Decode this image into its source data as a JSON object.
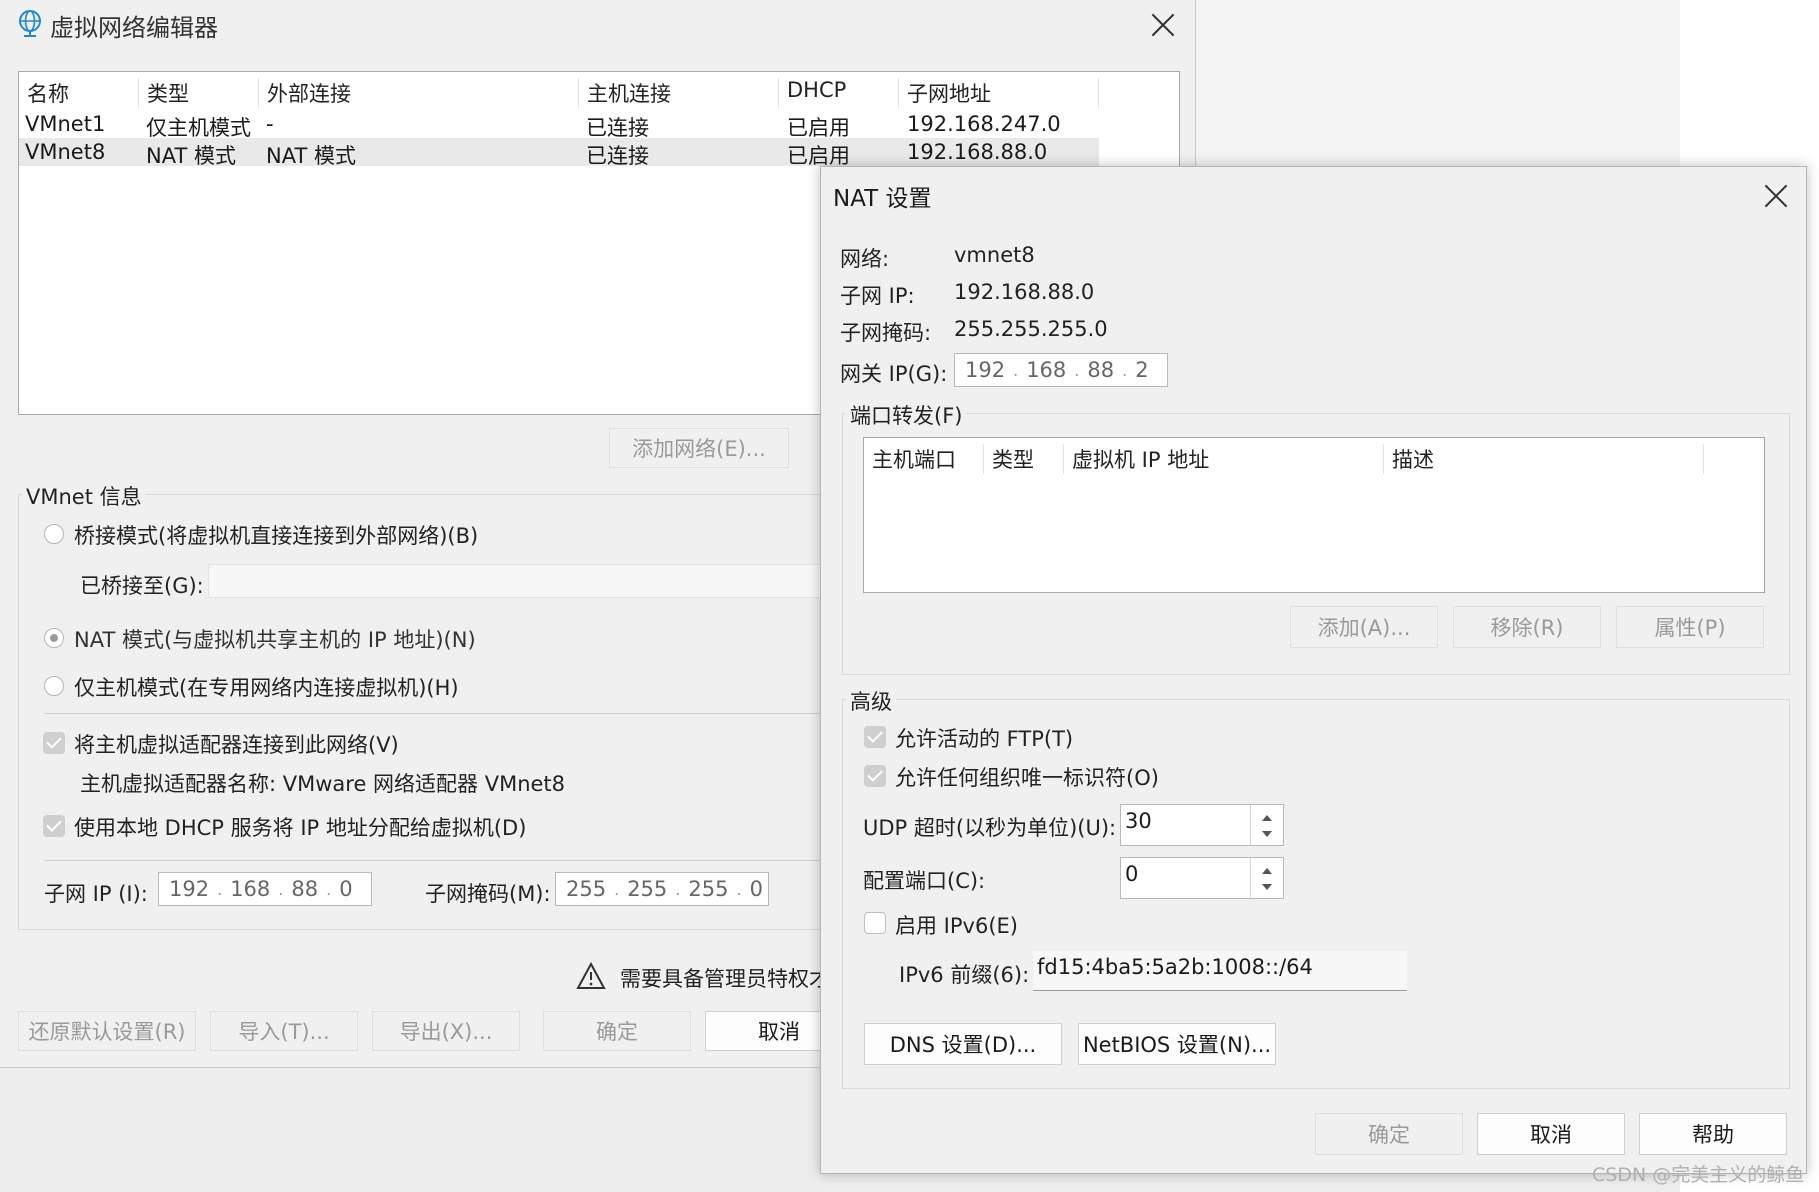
{
  "main": {
    "title": "虚拟网络编辑器",
    "columns": [
      "名称",
      "类型",
      "外部连接",
      "主机连接",
      "DHCP",
      "子网地址"
    ],
    "rows": [
      [
        "VMnet1",
        "仅主机模式",
        "-",
        "已连接",
        "已启用",
        "192.168.247.0"
      ],
      [
        "VMnet8",
        "NAT 模式",
        "NAT 模式",
        "已连接",
        "已启用",
        "192.168.88.0"
      ]
    ],
    "add_network": "添加网络(E)...",
    "vmnet_info": "VMnet 信息",
    "bridge_mode": "桥接模式(将虚拟机直接连接到外部网络)(B)",
    "bridged_to": "已桥接至(G):",
    "nat_mode": "NAT 模式(与虚拟机共享主机的 IP 地址)(N)",
    "host_only": "仅主机模式(在专用网络内连接虚拟机)(H)",
    "connect_adapter": "将主机虚拟适配器连接到此网络(V)",
    "adapter_name": "主机虚拟适配器名称: VMware 网络适配器 VMnet8",
    "use_dhcp": "使用本地 DHCP 服务将 IP 地址分配给虚拟机(D)",
    "subnet_ip_label": "子网 IP (I):",
    "subnet_ip": [
      "192",
      "168",
      "88",
      "0"
    ],
    "subnet_mask_label": "子网掩码(M):",
    "subnet_mask": [
      "255",
      "255",
      "255",
      "0"
    ],
    "admin_warning": "需要具备管理员特权才",
    "restore_defaults": "还原默认设置(R)",
    "import": "导入(T)...",
    "export": "导出(X)...",
    "ok": "确定",
    "cancel": "取消"
  },
  "nat": {
    "title": "NAT 设置",
    "network_label": "网络:",
    "network_value": "vmnet8",
    "subnet_ip_label": "子网 IP:",
    "subnet_ip_value": "192.168.88.0",
    "subnet_mask_label": "子网掩码:",
    "subnet_mask_value": "255.255.255.0",
    "gateway_label": "网关 IP(G):",
    "gateway": [
      "192",
      "168",
      "88",
      "2"
    ],
    "port_forwarding": "端口转发(F)",
    "pf_columns": [
      "主机端口",
      "类型",
      "虚拟机 IP 地址",
      "描述"
    ],
    "add": "添加(A)...",
    "remove": "移除(R)",
    "properties": "属性(P)",
    "advanced": "高级",
    "allow_ftp": "允许活动的 FTP(T)",
    "allow_oui": "允许任何组织唯一标识符(O)",
    "udp_timeout_label": "UDP 超时(以秒为单位)(U):",
    "udp_timeout": "30",
    "config_port_label": "配置端口(C):",
    "config_port": "0",
    "enable_ipv6": "启用 IPv6(E)",
    "ipv6_prefix_label": "IPv6 前缀(6):",
    "ipv6_prefix": "fd15:4ba5:5a2b:1008::/64",
    "dns_settings": "DNS 设置(D)...",
    "netbios_settings": "NetBIOS 设置(N)...",
    "ok": "确定",
    "cancel": "取消",
    "help": "帮助"
  },
  "watermark": "CSDN @完美主义的鲸鱼"
}
